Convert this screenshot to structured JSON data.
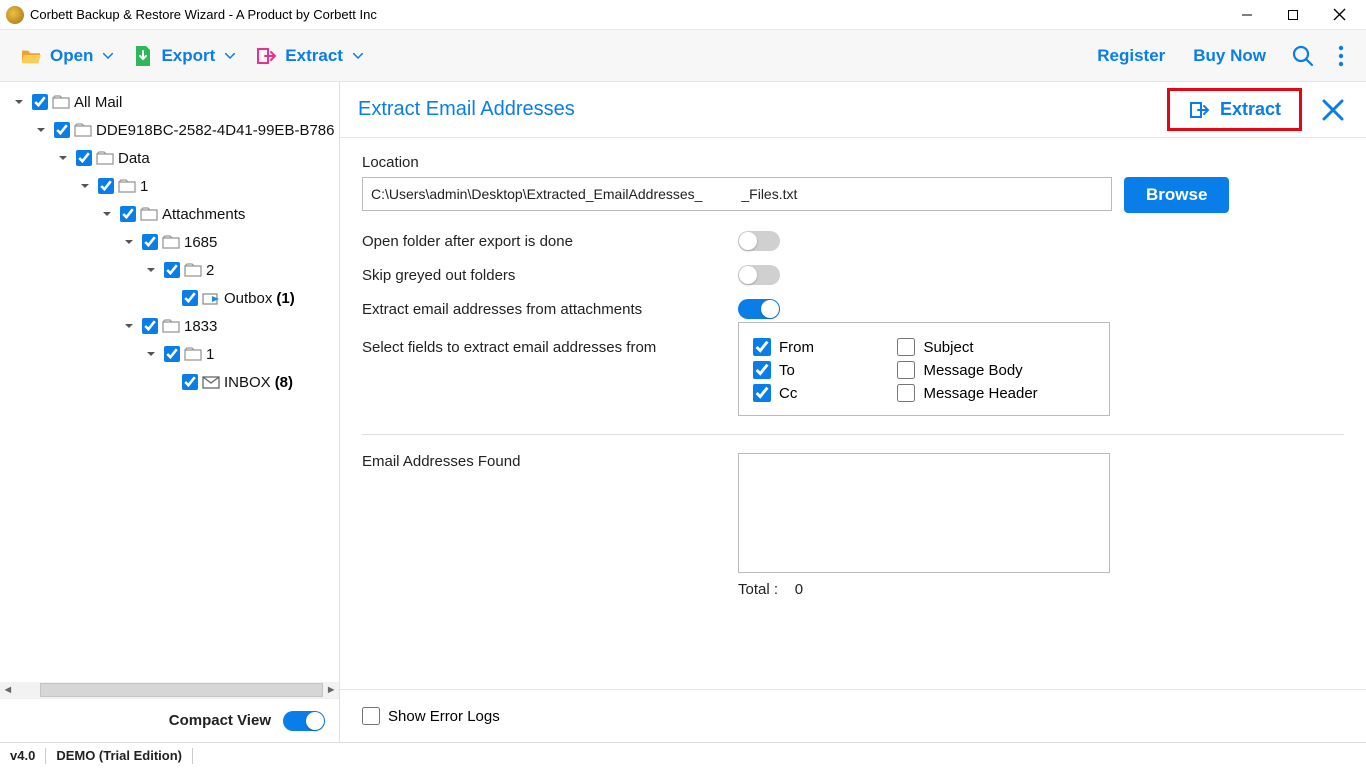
{
  "window": {
    "title": "Corbett Backup & Restore Wizard - A Product by Corbett Inc"
  },
  "toolbar": {
    "open": "Open",
    "export": "Export",
    "extract": "Extract",
    "register": "Register",
    "buy_now": "Buy Now"
  },
  "tree": {
    "root": "All Mail",
    "guid": "DDE918BC-2582-4D41-99EB-B786",
    "data": "Data",
    "n1a": "1",
    "attachments": "Attachments",
    "n1685": "1685",
    "n2": "2",
    "outbox": "Outbox",
    "outbox_count": "(1)",
    "n1833": "1833",
    "n1b": "1",
    "inbox": "INBOX",
    "inbox_count": "(8)"
  },
  "sidebar": {
    "compact": "Compact View"
  },
  "panel": {
    "title": "Extract Email Addresses",
    "extract_btn": "Extract",
    "location_label": "Location",
    "location_value": "C:\\Users\\admin\\Desktop\\Extracted_EmailAddresses_          _Files.txt",
    "browse": "Browse",
    "open_after": "Open folder after export is done",
    "skip_greyed": "Skip greyed out folders",
    "extract_attach": "Extract email addresses from attachments",
    "select_fields": "Select fields to extract email addresses from",
    "cb_from": "From",
    "cb_to": "To",
    "cb_cc": "Cc",
    "cb_subject": "Subject",
    "cb_body": "Message Body",
    "cb_header": "Message Header",
    "found_label": "Email Addresses Found",
    "total_label": "Total :",
    "total_value": "0",
    "show_errors": "Show Error Logs"
  },
  "status": {
    "version": "v4.0",
    "edition": "DEMO (Trial Edition)"
  }
}
